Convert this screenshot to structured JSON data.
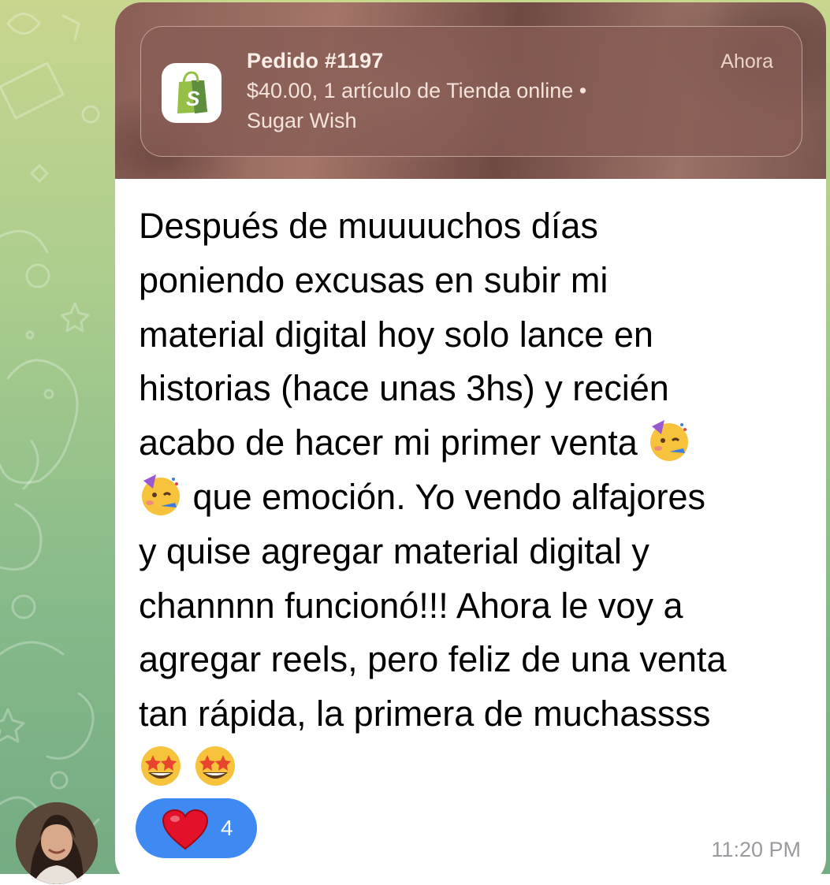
{
  "notification": {
    "app_icon": "shopify-bag-icon",
    "title": "Pedido #1197",
    "line1": "$40.00, 1 artículo de Tienda online •",
    "line2": "Sugar Wish",
    "time": "Ahora"
  },
  "message": {
    "lines": [
      "Después de muuuuchos días",
      "poniendo excusas en subir mi",
      "material digital hoy solo lance en",
      "historias (hace unas 3hs) y recién",
      "acabo de hacer mi primer venta",
      "que emoción. Yo vendo alfajores",
      "y quise agregar material digital y",
      "channnn funcionó!!! Ahora le voy a",
      "agregar reels, pero feliz de una venta",
      "tan rápida, la primera de muchassss"
    ],
    "emoji_party": "partying-face-emoji",
    "emoji_star": "star-struck-emoji",
    "time": "11:20 PM"
  },
  "reaction": {
    "icon": "red-heart-icon",
    "count": "4",
    "color": "#3f8af2"
  },
  "sender": {
    "avatar": "sender-avatar"
  },
  "colors": {
    "chat_background": "#a9cc8d",
    "bubble": "#ffffff",
    "notification_bg": "#875c54"
  }
}
